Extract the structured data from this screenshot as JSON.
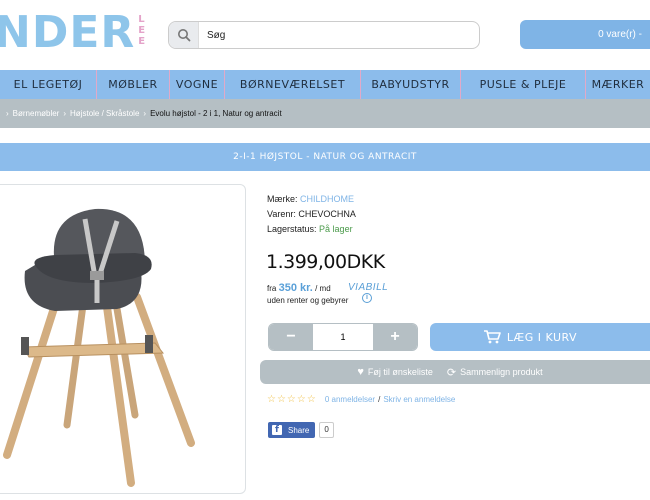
{
  "header": {
    "logo_main": "NDER",
    "logo_side": "LEE",
    "search_placeholder": "Søg",
    "cart_label": "0 vare(r) -"
  },
  "nav": {
    "items": [
      "EL LEGETØJ",
      "MØBLER",
      "VOGNE",
      "BØRNEVÆRELSET",
      "BABYUDSTYR",
      "PUSLE & PLEJE",
      "MÆRKER"
    ]
  },
  "breadcrumb": {
    "items": [
      "Børnemøbler",
      "Højstole / Skråstole"
    ],
    "current": "Evolu højstol - 2 i 1, Natur og antracit"
  },
  "product": {
    "title": "2-I-1 HØJSTOL - NATUR OG ANTRACIT",
    "brand_label": "Mærke:",
    "brand": "CHILDHOME",
    "sku_label": "Varenr:",
    "sku": "CHEVOCHNA",
    "stock_label": "Lagerstatus:",
    "stock": "På lager",
    "price": "1.399,00DKK",
    "finance_prefix": "fra",
    "finance_amount": "350 kr.",
    "finance_suffix": "/ md",
    "finance_note": "uden renter og gebyrer",
    "finance_provider": "VIABILL",
    "quantity": "1",
    "add_to_cart": "LÆG I KURV",
    "wishlist": "Føj til ønskeliste",
    "compare": "Sammenlign produkt",
    "reviews_count": "0 anmeldelser",
    "write_review": "Skriv en anmeldelse",
    "share_label": "Share",
    "share_count": "0"
  },
  "colors": {
    "accent_blue": "#8cbceb",
    "grey": "#b5bfc4",
    "logo_pink": "#e4a3c9",
    "in_stock_green": "#4a9a4a"
  }
}
